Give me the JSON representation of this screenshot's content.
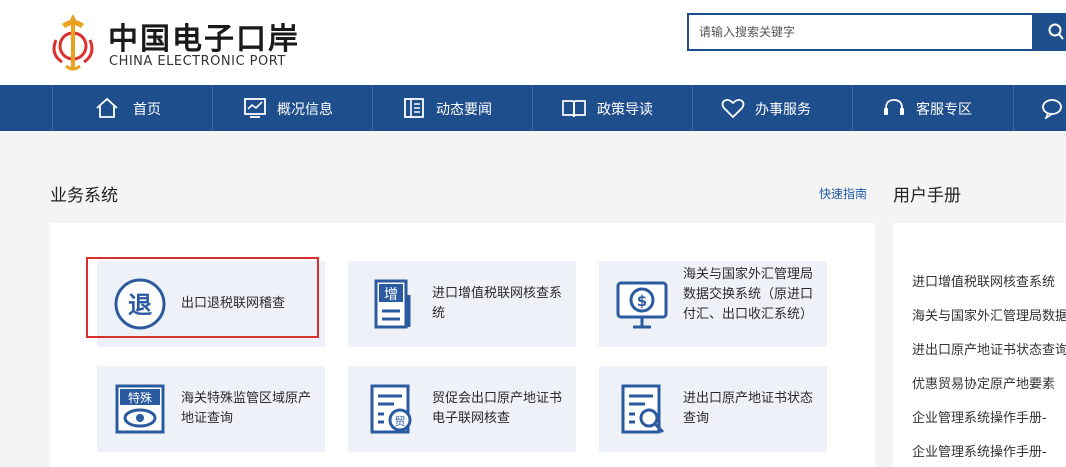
{
  "brand": {
    "title_cn": "中国电子口岸",
    "title_en": "CHINA ELECTRONIC PORT"
  },
  "search": {
    "placeholder": "请输入搜索关键字"
  },
  "nav": {
    "items": [
      {
        "label": "首页",
        "icon": "home-icon"
      },
      {
        "label": "概况信息",
        "icon": "chart-monitor-icon"
      },
      {
        "label": "动态要闻",
        "icon": "news-icon"
      },
      {
        "label": "政策导读",
        "icon": "book-icon"
      },
      {
        "label": "办事服务",
        "icon": "heart-icon"
      },
      {
        "label": "客服专区",
        "icon": "headset-icon"
      }
    ]
  },
  "business": {
    "title": "业务系统",
    "quick_link": "快速指南",
    "cards": [
      {
        "label": "出口退税联网稽查",
        "icon": "refund-icon",
        "icon_text": "退"
      },
      {
        "label": "进口增值税联网核查系统",
        "icon": "vat-document-icon",
        "icon_text": "增"
      },
      {
        "label": "海关与国家外汇管理局数据交换系统（原进口付汇、出口收汇系统）",
        "icon": "forex-monitor-icon"
      },
      {
        "label": "海关特殊监管区域原产地证查询",
        "icon": "special-zone-eye-icon",
        "icon_text": "特殊"
      },
      {
        "label": "贸促会出口原产地证书电子联网核查",
        "icon": "trade-certificate-icon",
        "icon_text": "贸"
      },
      {
        "label": "进出口原产地证书状态查询",
        "icon": "certificate-search-icon"
      }
    ]
  },
  "manual": {
    "title": "用户手册",
    "items": [
      "进口增值税联网核查系统",
      "海关与国家外汇管理局数据",
      "进出口原产地证书状态查询",
      "优惠贸易协定原产地要素",
      "企业管理系统操作手册-",
      "企业管理系统操作手册-"
    ]
  },
  "colors": {
    "nav_bg": "#1f4e8c",
    "accent": "#1f5aa6",
    "highlight": "#d9322e",
    "card_bg": "#eef2f8"
  }
}
